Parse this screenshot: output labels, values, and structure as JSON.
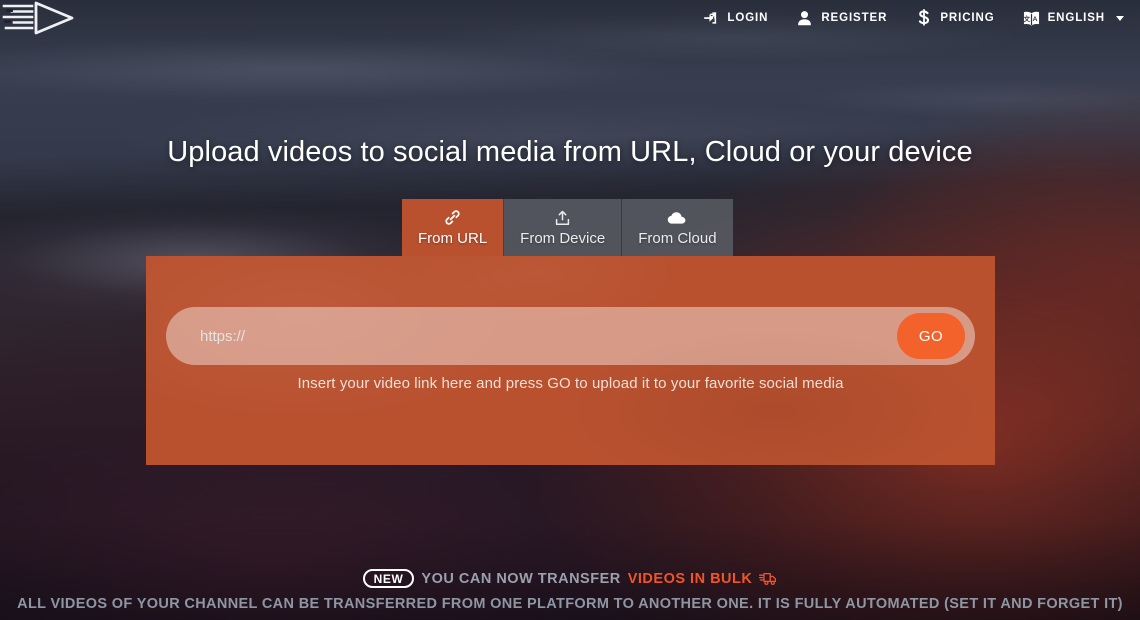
{
  "header": {
    "logo_name": "video-play-logo",
    "nav": [
      {
        "label": "LOGIN",
        "icon": "login-icon",
        "name": "nav-item-login"
      },
      {
        "label": "REGISTER",
        "icon": "user-icon",
        "name": "nav-item-register"
      },
      {
        "label": "PRICING",
        "icon": "dollar-icon",
        "name": "nav-item-pricing"
      },
      {
        "label": "ENGLISH",
        "icon": "language-icon",
        "name": "nav-item-language",
        "has_caret": true
      }
    ]
  },
  "hero": {
    "title": "Upload videos to social media from URL, Cloud or your device"
  },
  "tabs": [
    {
      "label": "From URL",
      "icon": "link-icon",
      "active": true
    },
    {
      "label": "From Device",
      "icon": "upload-icon",
      "active": false
    },
    {
      "label": "From Cloud",
      "icon": "cloud-icon",
      "active": false
    }
  ],
  "upload_panel": {
    "url_input_value": "",
    "url_input_placeholder": "https://",
    "go_label": "GO",
    "hint": "Insert your video link here and press GO to upload it to your favorite social media"
  },
  "promo": {
    "badge": "NEW",
    "line1_prefix": "YOU CAN NOW TRANSFER",
    "line1_accent": "VIDEOS IN BULK",
    "line1_icon": "shipping-truck-icon",
    "line2": "ALL VIDEOS OF YOUR CHANNEL CAN BE TRANSFERRED FROM ONE PLATFORM TO ANOTHER ONE. IT IS FULLY AUTOMATED (SET IT AND FORGET IT)"
  },
  "colors": {
    "panel_orange": "#b9512f",
    "go_orange": "#f4622c",
    "accent_orange": "#f2542a",
    "promo_gray": "#9aa1ad",
    "sky_dark": "#3c4253"
  }
}
